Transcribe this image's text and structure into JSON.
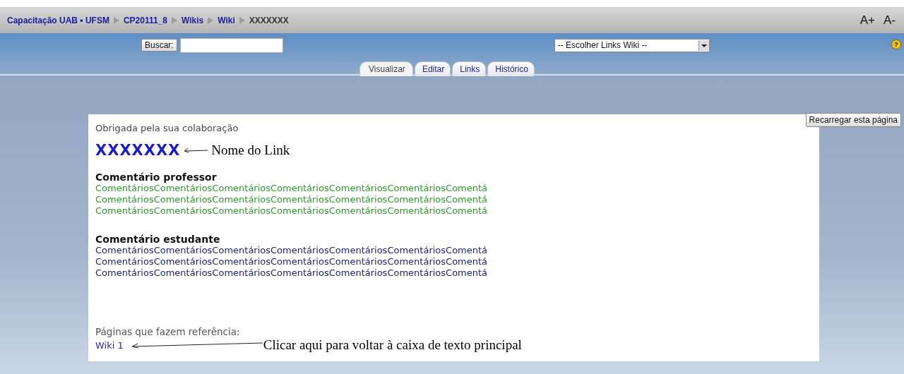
{
  "breadcrumb": {
    "links": [
      "Capacitação UAB • UFSM",
      "CP20111_8",
      "Wikis",
      "Wiki"
    ],
    "current": "XXXXXXX"
  },
  "font_controls": [
    "A+",
    "A-"
  ],
  "search": {
    "button": "Buscar:"
  },
  "links_select": {
    "value": "-- Escolher Links Wiki --"
  },
  "help": "?",
  "tabs": [
    {
      "label": "Visualizar",
      "selected": true
    },
    {
      "label": "Editar",
      "selected": false
    },
    {
      "label": "Links",
      "selected": false
    },
    {
      "label": "Histórico",
      "selected": false
    }
  ],
  "reload_button": "Recarregar esta página",
  "content": {
    "message": "Obrigada pela sua colaboração",
    "title": "XXXXXXX",
    "title_note": "Nome do Link",
    "sections": [
      {
        "kind": "teacher",
        "heading": "Comentário professor",
        "lines": [
          "ComentáriosComentáriosComentáriosComentáriosComentáriosComentáriosComentá",
          "ComentáriosComentáriosComentáriosComentáriosComentáriosComentáriosComentá",
          "ComentáriosComentáriosComentáriosComentáriosComentáriosComentáriosComentá"
        ]
      },
      {
        "kind": "student",
        "heading": "Comentário estudante",
        "lines": [
          "ComentáriosComentáriosComentáriosComentáriosComentáriosComentáriosComentá",
          "ComentáriosComentáriosComentáriosComentáriosComentáriosComentáriosComentá",
          "ComentáriosComentáriosComentáriosComentáriosComentáriosComentáriosComentá"
        ]
      }
    ],
    "references": {
      "label": "Páginas que fazem referência:",
      "link": "Wiki 1",
      "note": "Clicar aqui para voltar à caixa de texto principal"
    }
  }
}
